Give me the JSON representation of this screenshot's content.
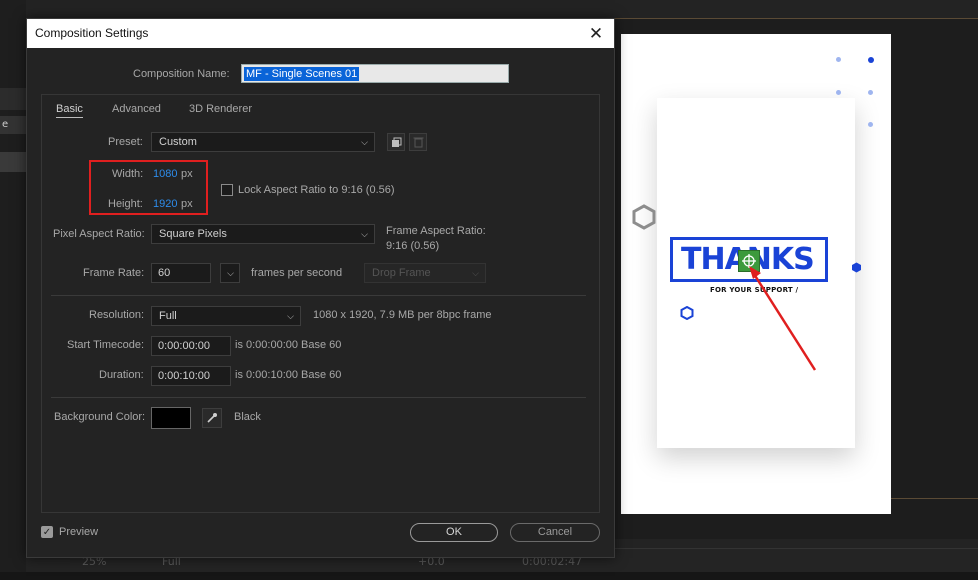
{
  "dialog": {
    "title": "Composition Settings",
    "close_glyph": "✕",
    "comp_name_label": "Composition Name:",
    "comp_name_value": "MF - Single Scenes 01",
    "tabs": [
      {
        "label": "Basic",
        "active": true
      },
      {
        "label": "Advanced",
        "active": false
      },
      {
        "label": "3D Renderer",
        "active": false
      }
    ],
    "preset": {
      "label": "Preset:",
      "value": "Custom"
    },
    "width": {
      "label": "Width:",
      "value": "1080",
      "unit": "px"
    },
    "height": {
      "label": "Height:",
      "value": "1920",
      "unit": "px"
    },
    "lock_aspect": {
      "label": "Lock Aspect Ratio to 9:16 (0.56)",
      "checked": false
    },
    "pixel_aspect": {
      "label": "Pixel Aspect Ratio:",
      "value": "Square Pixels"
    },
    "frame_aspect": {
      "label": "Frame Aspect Ratio:",
      "value": "9:16 (0.56)"
    },
    "frame_rate": {
      "label": "Frame Rate:",
      "value": "60",
      "unit": "frames per second",
      "drop_frame": "Drop Frame"
    },
    "resolution": {
      "label": "Resolution:",
      "value": "Full",
      "info": "1080 x 1920, 7.9 MB per 8bpc frame"
    },
    "start_timecode": {
      "label": "Start Timecode:",
      "value": "0:00:00:00",
      "info": "is 0:00:00:00  Base 60"
    },
    "duration": {
      "label": "Duration:",
      "value": "0:00:10:00",
      "info": "is 0:00:10:00  Base 60"
    },
    "background_color": {
      "label": "Background Color:",
      "name": "Black",
      "hex": "#000000"
    },
    "preview": {
      "label": "Preview",
      "checked": true
    },
    "ok_label": "OK",
    "cancel_label": "Cancel",
    "highlight_color": "#e01f1f"
  },
  "app": {
    "left_tab_text": "e",
    "bottom_bar": {
      "zoom": "25%",
      "quality": "Full",
      "exposure": "+0.0",
      "timecode": "0:00:02:47"
    }
  },
  "preview": {
    "headline": "THANKS",
    "subline": "FOR YOUR SUPPORT /",
    "brand_color": "#1a43d6",
    "arrow_color": "#e01f1f"
  }
}
